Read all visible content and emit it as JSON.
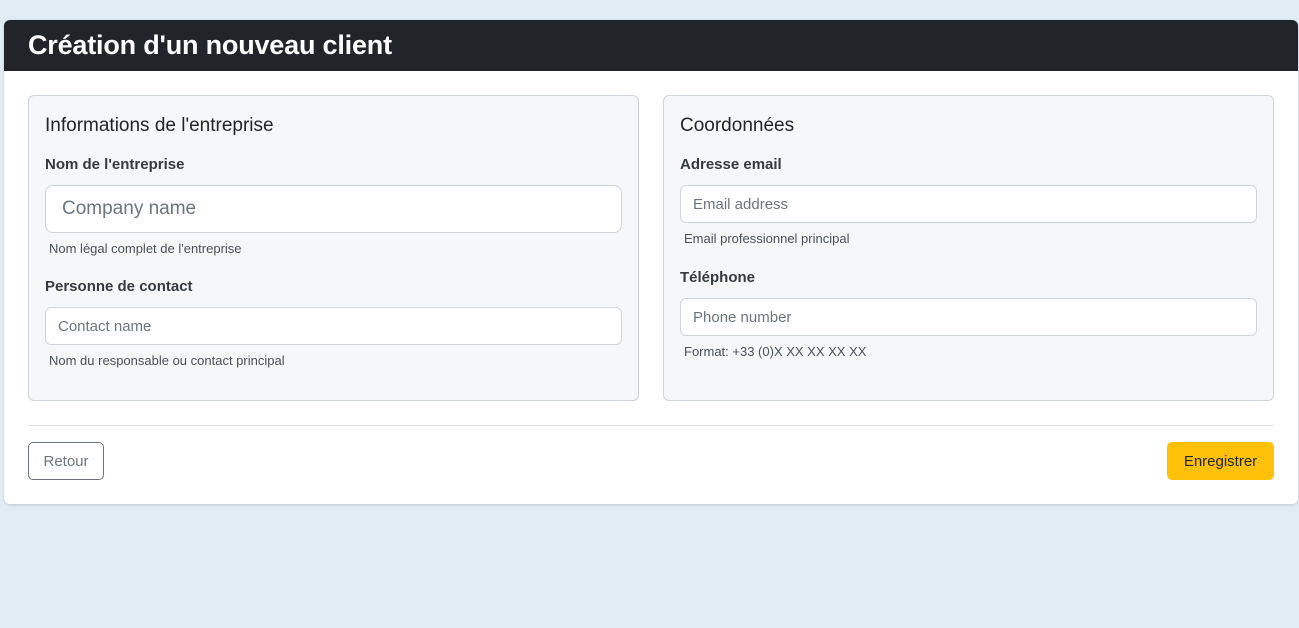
{
  "header": {
    "title": "Création d'un nouveau client"
  },
  "company_section": {
    "title": "Informations de l'entreprise",
    "company_name": {
      "label": "Nom de l'entreprise",
      "placeholder": "Company name",
      "value": "",
      "help": "Nom légal complet de l'entreprise"
    },
    "contact_person": {
      "label": "Personne de contact",
      "placeholder": "Contact name",
      "value": "",
      "help": "Nom du responsable ou contact principal"
    }
  },
  "contact_section": {
    "title": "Coordonnées",
    "email": {
      "label": "Adresse email",
      "placeholder": "Email address",
      "value": "",
      "help": "Email professionnel principal"
    },
    "phone": {
      "label": "Téléphone",
      "placeholder": "Phone number",
      "value": "",
      "help": "Format: +33 (0)X XX XX XX XX"
    }
  },
  "actions": {
    "back_label": "Retour",
    "save_label": "Enregistrer"
  },
  "colors": {
    "header_bg": "#212529",
    "page_bg": "#e1ecf5",
    "save_button": "#ffc107",
    "back_button_border": "#6c757d"
  }
}
